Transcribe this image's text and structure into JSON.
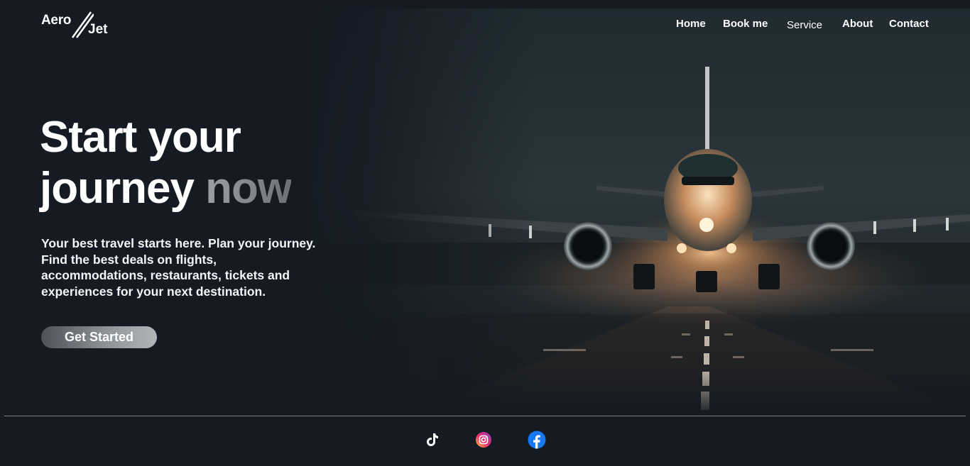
{
  "brand": {
    "logo_part1": "Aero",
    "logo_part2": "Jet"
  },
  "nav": {
    "items": [
      {
        "label": "Home"
      },
      {
        "label": "Book me"
      },
      {
        "label": "Service"
      },
      {
        "label": "About"
      },
      {
        "label": "Contact"
      }
    ]
  },
  "hero": {
    "headline_line1": "Start your",
    "headline_word": "journey",
    "headline_faded": "now",
    "description": "Your best travel starts here. Plan your journey. Find the best deals on flights, accommodations, restaurants, tickets and experiences for your next destination.",
    "cta_label": "Get Started",
    "image_icon": "airplane-landing-runway"
  },
  "socials": [
    {
      "name": "tiktok",
      "icon": "tiktok-icon"
    },
    {
      "name": "instagram",
      "icon": "instagram-icon"
    },
    {
      "name": "facebook",
      "icon": "facebook-icon"
    }
  ],
  "colors": {
    "background": "#151a23",
    "text": "#ffffff",
    "faded_text": "#8a9096",
    "button_gradient_start": "#4d5158",
    "button_gradient_end": "#b3b6b9",
    "divider": "#7d8188",
    "facebook_blue": "#1877f2"
  }
}
